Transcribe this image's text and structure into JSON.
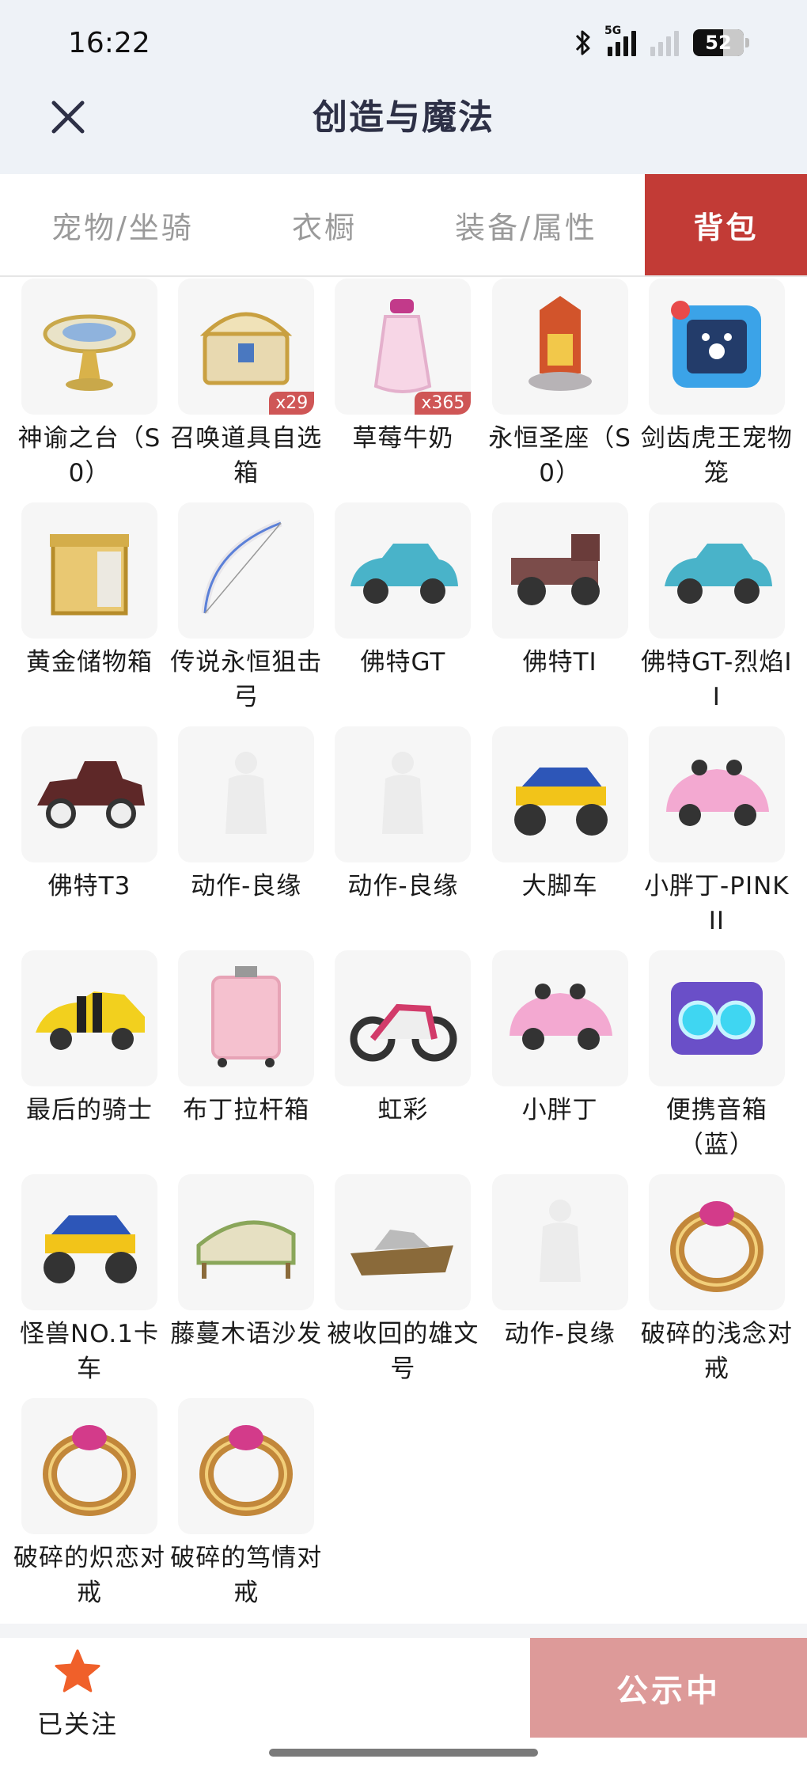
{
  "status_bar": {
    "time": "16:22",
    "network": "5G",
    "battery": "52"
  },
  "header": {
    "title": "创造与魔法",
    "close_icon": "close-icon"
  },
  "tabs": [
    {
      "label": "宠物/坐骑",
      "active": false
    },
    {
      "label": "衣橱",
      "active": false
    },
    {
      "label": "装备/属性",
      "active": false
    },
    {
      "label": "背包",
      "active": true
    }
  ],
  "items": [
    {
      "name": "神谕之台（S0）",
      "icon": "oracle-platform-icon",
      "qty": ""
    },
    {
      "name": "召唤道具自选箱",
      "icon": "treasure-chest-icon",
      "qty": "x29"
    },
    {
      "name": "草莓牛奶",
      "icon": "milk-bottle-icon",
      "qty": "x365"
    },
    {
      "name": "永恒圣座（S0）",
      "icon": "throne-icon",
      "qty": ""
    },
    {
      "name": "剑齿虎王宠物笼",
      "icon": "pet-cage-icon",
      "qty": ""
    },
    {
      "name": "黄金储物箱",
      "icon": "gold-storage-box-icon",
      "qty": ""
    },
    {
      "name": "传说永恒狙击弓",
      "icon": "bow-icon",
      "qty": ""
    },
    {
      "name": "佛特GT",
      "icon": "car-icon",
      "qty": ""
    },
    {
      "name": "佛特TI",
      "icon": "truck-icon",
      "qty": ""
    },
    {
      "name": "佛特GT-烈焰II",
      "icon": "car-icon",
      "qty": ""
    },
    {
      "name": "佛特T3",
      "icon": "vintage-car-icon",
      "qty": ""
    },
    {
      "name": "动作-良缘",
      "icon": "emote-placeholder-icon",
      "qty": ""
    },
    {
      "name": "动作-良缘",
      "icon": "emote-placeholder-icon",
      "qty": ""
    },
    {
      "name": "大脚车",
      "icon": "monster-truck-icon",
      "qty": ""
    },
    {
      "name": "小胖丁-PINK II",
      "icon": "beetle-car-icon",
      "qty": ""
    },
    {
      "name": "最后的骑士",
      "icon": "sports-car-icon",
      "qty": ""
    },
    {
      "name": "布丁拉杆箱",
      "icon": "suitcase-icon",
      "qty": ""
    },
    {
      "name": "虹彩",
      "icon": "motorcycle-icon",
      "qty": ""
    },
    {
      "name": "小胖丁",
      "icon": "beetle-car-icon",
      "qty": ""
    },
    {
      "name": "便携音箱（蓝）",
      "icon": "speaker-icon",
      "qty": ""
    },
    {
      "name": "怪兽NO.1卡车",
      "icon": "monster-truck-icon",
      "qty": ""
    },
    {
      "name": "藤蔓木语沙发",
      "icon": "sofa-icon",
      "qty": ""
    },
    {
      "name": "被收回的雄文号",
      "icon": "ship-icon",
      "qty": ""
    },
    {
      "name": "动作-良缘",
      "icon": "emote-placeholder-icon",
      "qty": ""
    },
    {
      "name": "破碎的浅念对戒",
      "icon": "ring-icon",
      "qty": ""
    },
    {
      "name": "破碎的炽恋对戒",
      "icon": "ring-icon",
      "qty": ""
    },
    {
      "name": "破碎的笃情对戒",
      "icon": "ring-icon",
      "qty": ""
    }
  ],
  "footer": {
    "follow_label": "已关注",
    "follow_icon": "star-icon",
    "public_button": "公示中"
  },
  "colors": {
    "accent": "#c23b36",
    "public_button": "#dd9a99",
    "star": "#f0602a",
    "qty_badge": "#cf5656"
  }
}
